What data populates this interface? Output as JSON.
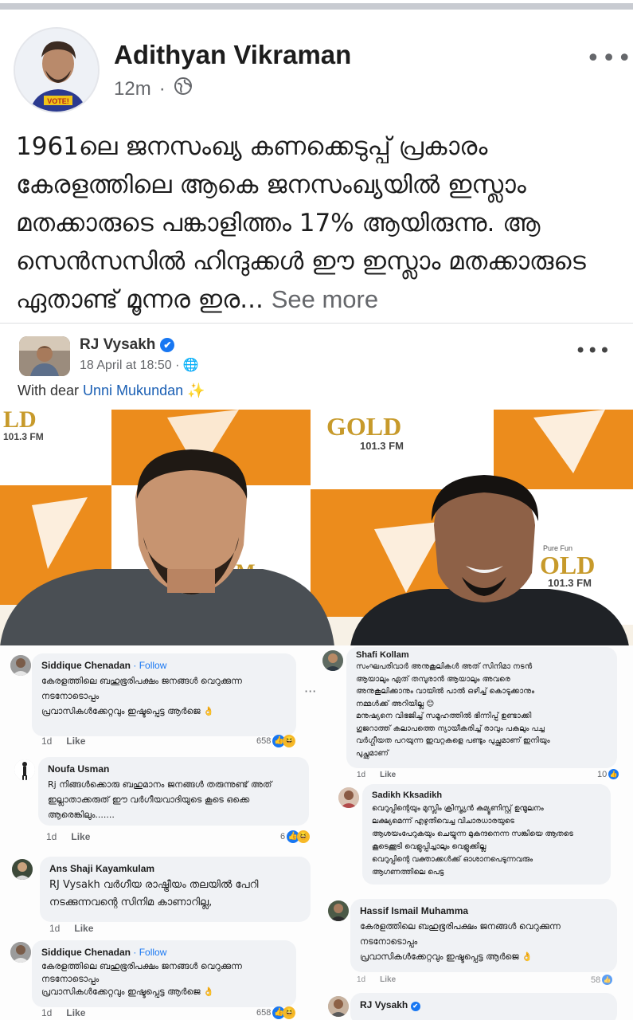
{
  "post": {
    "author": "Adithyan Vikraman",
    "time": "12m",
    "separator": "·",
    "privacy_icon": "globe-icon",
    "more_icon": "•••",
    "text": "1961ലെ ജനസംഖ്യ കണക്കെടുപ്പ് പ്രകാരം കേരളത്തിലെ ആകെ ജനസംഖ്യയിൽ ഇസ്ലാം മതക്കാരുടെ പങ്കാളിത്തം 17% ആയിരുന്നു. ആ സെൻസസിൽ ഹിന്ദുക്കൾ ഈ ഇസ്ലാം മതക്കാരുടെ ഏതാണ്ട് മൂന്നര ഇര",
    "ellipsis": "...",
    "see_more": "See more",
    "avatar_badge": "VOTE!"
  },
  "shared": {
    "author": "RJ Vysakh",
    "verified_icon": "✔",
    "meta": "18 April at 18:50 · ",
    "more_icon": "•••",
    "caption_prefix": "With dear ",
    "caption_tag": "Unni Mukundan",
    "caption_suffix": " ✨",
    "photo": {
      "logo_text": "GOLD",
      "logo_freq": "101.3 FM",
      "logo_left_partial": "LD",
      "logo_left_freq": "101.3 FM",
      "logo_right_partial": "OLD",
      "logo_right_freq": "101.3 FM",
      "logo_mid_partial": "M",
      "tagline": "Pure Fun"
    }
  },
  "comments": [
    {
      "name": "Siddique Chenadan",
      "sep": " · ",
      "follow": "Follow",
      "lines": [
        "കേരളത്തിലെ ബഹുഭൂരിപക്ഷം ജനങ്ങൾ വെറുക്കുന്ന",
        "നടനോടൊപ്പം",
        "പ്രവാസികൾക്കേറ്റവും ഇഷ്ടപ്പെട്ട ആർജെ 👌"
      ],
      "time": "1d",
      "like": "Like",
      "count": "658"
    },
    {
      "name": "Noufa Usman",
      "lines": [
        "Rj നിങ്ങൾക്കൊരു ബഹുമാനം ജനങ്ങൾ തരുന്നുണ്ട് അത്",
        "ഇല്ലാതാക്കരുത് ഈ വർഗീയവാദിയുടെ കൂടെ ഒക്കെ",
        "ആരെങ്കിലും......."
      ],
      "time": "1d",
      "like": "Like",
      "count": "6"
    },
    {
      "name": "Ans Shaji Kayamkulam",
      "lines": [
        "RJ Vysakh വർഗീയ രാഷ്ട്രീയം തലയിൽ പേറി",
        "നടക്കുന്നവന്റെ സിനിമ കാണാറില്ല,"
      ],
      "time": "1d",
      "like": "Like"
    },
    {
      "name": "Siddique Chenadan",
      "sep": " · ",
      "follow": "Follow",
      "lines": [
        "കേരളത്തിലെ ബഹുഭൂരിപക്ഷം ജനങ്ങൾ വെറുക്കുന്ന",
        "നടനോടൊപ്പം",
        "പ്രവാസികൾക്കേറ്റവും ഇഷ്ടപ്പെട്ട ആർജെ 👌"
      ],
      "time": "1d",
      "like": "Like",
      "count": "658"
    },
    {
      "name": "Shafi Kollam",
      "lines": [
        "സംഘപരിവാർ അനുകൂലികൾ അത് സിനിമാ നടൻ",
        "ആയാലും ഏത് തമ്പുരാൻ ആയാലും അവരെ",
        "അനുകൂലിക്കാനും വായിൽ പാൽ ഒഴിച്ച് കൊടുക്കാനും",
        "നമ്മൾക്ക് അറിയില്ല 😊",
        "മനുഷ്യനെ വിഭജിച്ച് സമൂഹത്തിൽ ഭിന്നിപ്പ് ഉണ്ടാക്കി",
        "ഗുജറാത്ത് കലാപത്തെ ന്യായീകരിച്ച് രാവും പകലും പച്ച",
        "വർഗ്ഗീയത പറയുന്ന ഇവറ്റകളെ പണ്ടും പുച്ഛമാണ് ഇനിയും",
        "പുച്ഛമാണ്"
      ],
      "time": "1d",
      "like": "Like",
      "count": "10"
    },
    {
      "name": "Sadikh Kksadikh",
      "lines": [
        "വെറുപ്പിന്റെയും മുസ്ലിം ക്രിസ്ത്യൻ കമ്യൂണിസ്റ്റ് ഉന്മൂലനം",
        "ലക്ഷ്യമെന്ന് എഴുതിവെച്ച വിചാരധാരയുടെ",
        "ആശയംപേറുകയും ചെയ്യുന്ന മുകന്ദനെന്ന സങ്കിയെ ആതടെ",
        "കൂടെക്കൂടി വെളുപ്പിച്ചാലും വെളുക്കില്ല",
        "വെറുപ്പിന്റെ വക്താക്കൾക്ക് ഓശാനപെടുന്നവരും",
        "ആഗണത്തിലെ പെട്ട"
      ]
    },
    {
      "name": "Hassif Ismail Muhamma",
      "lines": [
        "കേരളത്തിലെ ബഹുഭൂരിപക്ഷം ജനങ്ങൾ വെറുക്കുന്ന",
        "നടനോടൊപ്പം",
        "പ്രവാസികൾക്കേറ്റവും ഇഷ്ടപ്പെട്ട ആർജെ 👌"
      ],
      "time": "1d",
      "like": "Like",
      "count": "58"
    },
    {
      "name": "RJ Vysakh"
    }
  ],
  "colors": {
    "link": "#1877f2",
    "meta": "#65676b",
    "bubble": "#f0f2f5",
    "gold": "#c79a2b",
    "tile_orange": "#e8891f"
  }
}
